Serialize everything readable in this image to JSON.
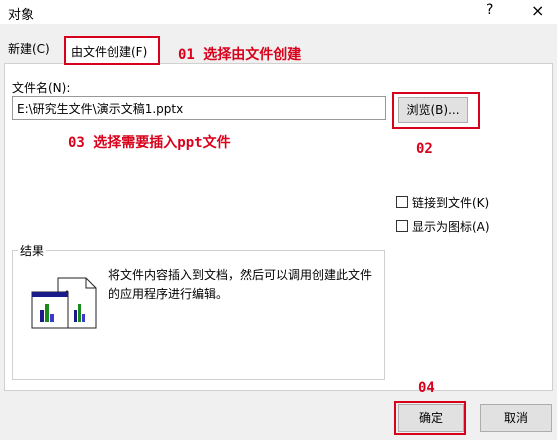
{
  "window": {
    "title": "对象",
    "help_icon": "?",
    "close_icon": "×"
  },
  "tabs": [
    {
      "label": "新建(C)"
    },
    {
      "label": "由文件创建(F)"
    }
  ],
  "file": {
    "label": "文件名(N):",
    "path": "E:\\研究生文件\\演示文稿1.pptx",
    "browse_label": "浏览(B)..."
  },
  "options": {
    "link_label": "链接到文件(K)",
    "icon_label": "显示为图标(A)"
  },
  "result": {
    "label": "结果",
    "text": "将文件内容插入到文档，然后可以调用创建此文件的应用程序进行编辑。",
    "icon": "insert-file-icon"
  },
  "buttons": {
    "ok": "确定",
    "cancel": "取消"
  },
  "annotations": {
    "a01": "01 选择由文件创建",
    "a02": "02",
    "a03": "03 选择需要插入ppt文件",
    "a04": "04"
  },
  "colors": {
    "annotation": "#d9001b"
  }
}
